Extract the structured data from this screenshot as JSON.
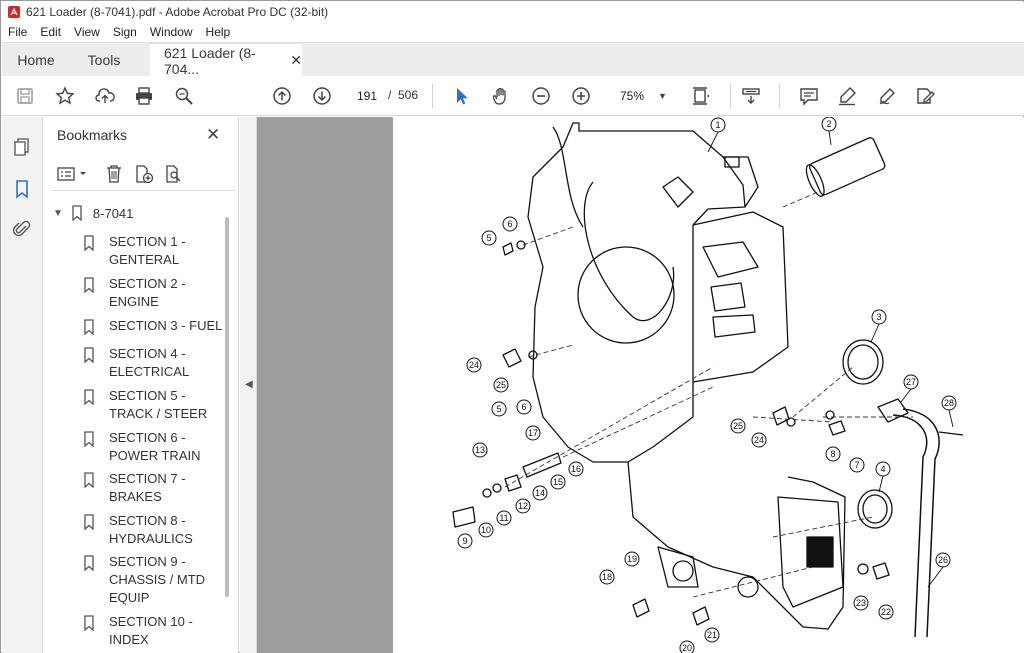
{
  "window": {
    "title": "621 Loader (8-7041).pdf - Adobe Acrobat Pro DC (32-bit)"
  },
  "menu": {
    "items": [
      "File",
      "Edit",
      "View",
      "Sign",
      "Window",
      "Help"
    ]
  },
  "tabs": {
    "home": "Home",
    "tools": "Tools",
    "document": "621 Loader (8-704...",
    "close_glyph": "✕"
  },
  "toolbar": {
    "current_page": "191",
    "page_separator": "/",
    "total_pages": "506",
    "zoom": "75%"
  },
  "bookmarks": {
    "title": "Bookmarks",
    "close_glyph": "✕",
    "root": "8-7041",
    "items": [
      {
        "label": "SECTION 1 - GENTERAL"
      },
      {
        "label": "SECTION 2 - ENGINE"
      },
      {
        "label": "SECTION 3 - FUEL"
      },
      {
        "label": "SECTION 4 - ELECTRICAL"
      },
      {
        "label": "SECTION 5 - TRACK / STEER"
      },
      {
        "label": "SECTION 6 - POWER TRAIN"
      },
      {
        "label": "SECTION 7 - BRAKES"
      },
      {
        "label": "SECTION 8 - HYDRAULICS"
      },
      {
        "label": "SECTION 9 - CHASSIS / MTD EQUIP"
      },
      {
        "label": "SECTION 10 - INDEX"
      }
    ]
  },
  "diagram": {
    "callouts": [
      "1",
      "2",
      "3",
      "4",
      "5",
      "6",
      "5",
      "6",
      "7",
      "8",
      "9",
      "10",
      "11",
      "12",
      "13",
      "14",
      "15",
      "16",
      "17",
      "18",
      "19",
      "20",
      "21",
      "22",
      "23",
      "24",
      "24",
      "25",
      "25",
      "26",
      "27",
      "28"
    ]
  },
  "colors": {
    "accent_blue": "#2f6fcc",
    "gutter_gray": "#9e9e9e",
    "tab_bar": "#eceded"
  }
}
